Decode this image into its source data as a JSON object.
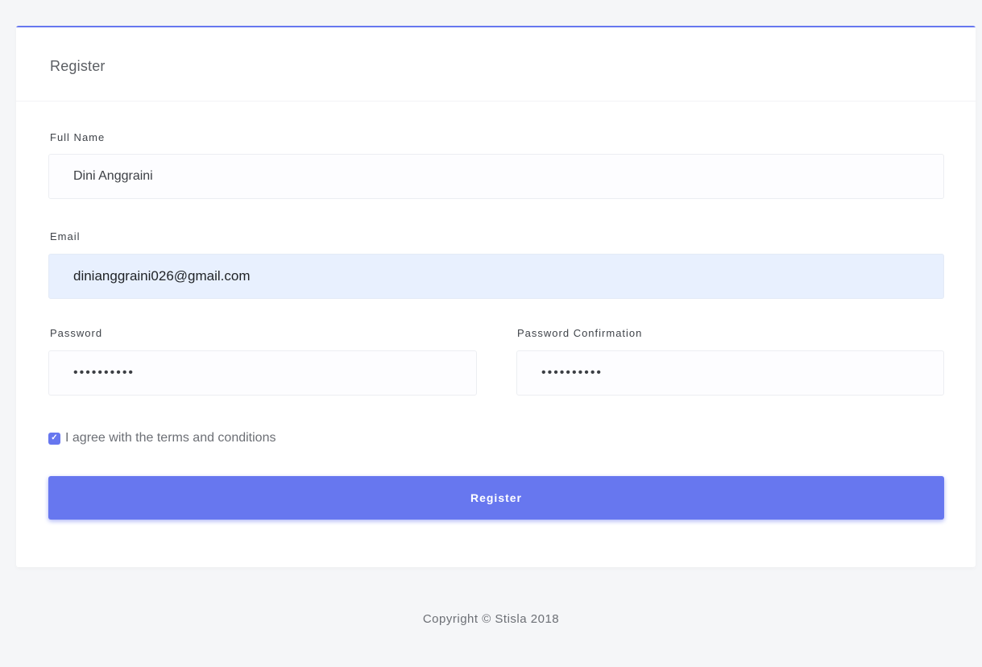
{
  "card": {
    "title": "Register",
    "accent_color": "#6777ef"
  },
  "form": {
    "full_name": {
      "label": "Full Name",
      "value": "Dini Anggraini"
    },
    "email": {
      "label": "Email",
      "value": "dinianggraini026@gmail.com"
    },
    "password": {
      "label": "Password",
      "value": "••••••••••"
    },
    "password_confirmation": {
      "label": "Password Confirmation",
      "value": "••••••••••"
    },
    "terms": {
      "label": "I agree with the terms and conditions",
      "checked": true
    },
    "submit_label": "Register"
  },
  "footer": {
    "text": "Copyright © Stisla 2018"
  }
}
